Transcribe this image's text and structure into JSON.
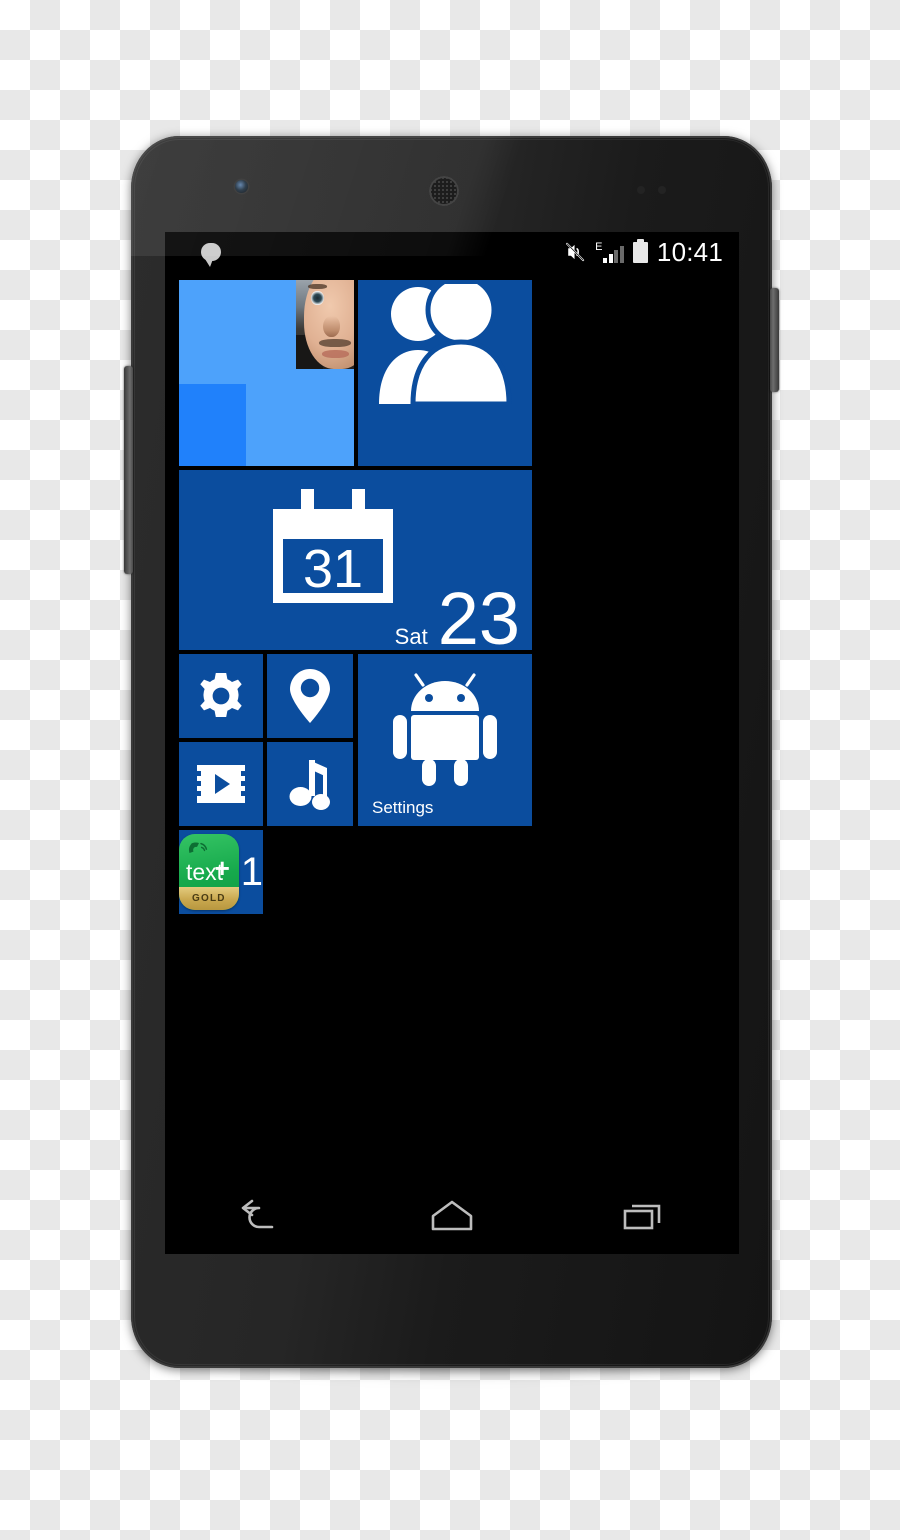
{
  "device": {
    "name": "android-smartphone",
    "body_color": "#262626",
    "screen_bg": "#000000"
  },
  "status_bar": {
    "notification_icon": "speech-bubble-icon",
    "icons": [
      {
        "name": "mute-icon",
        "label": "silent mode"
      },
      {
        "name": "edge-network-icon",
        "label": "E"
      },
      {
        "name": "signal-bars-icon",
        "label": "signal"
      },
      {
        "name": "battery-icon",
        "label": "battery full"
      }
    ],
    "network_type": "E",
    "clock": "10:41"
  },
  "home": {
    "accent_color": "#0b4d9e",
    "photo_tile_color": "#4da2fb",
    "photo_tile_block_color": "#2081fb",
    "tiles": [
      {
        "id": "photos",
        "icon": "photo-collage-icon",
        "label": ""
      },
      {
        "id": "people",
        "icon": "people-icon",
        "label": ""
      },
      {
        "id": "calendar",
        "icon": "calendar-31-icon",
        "label": "",
        "day_of_week": "Sat",
        "day_number": "23"
      },
      {
        "id": "settings-small",
        "icon": "gear-icon",
        "label": ""
      },
      {
        "id": "maps",
        "icon": "map-pin-icon",
        "label": ""
      },
      {
        "id": "video",
        "icon": "film-play-icon",
        "label": ""
      },
      {
        "id": "music",
        "icon": "music-note-icon",
        "label": ""
      },
      {
        "id": "android-settings",
        "icon": "android-robot-icon",
        "label": "Settings"
      },
      {
        "id": "textplus",
        "icon": "textplus-gold-icon",
        "label": "",
        "badge": "1",
        "app_name": "text",
        "app_plus": "+",
        "app_tier": "GOLD"
      }
    ]
  },
  "nav_bar": {
    "buttons": [
      {
        "name": "back-button",
        "icon": "back-arrow-icon"
      },
      {
        "name": "home-button",
        "icon": "home-icon"
      },
      {
        "name": "recents-button",
        "icon": "recents-icon"
      }
    ]
  }
}
